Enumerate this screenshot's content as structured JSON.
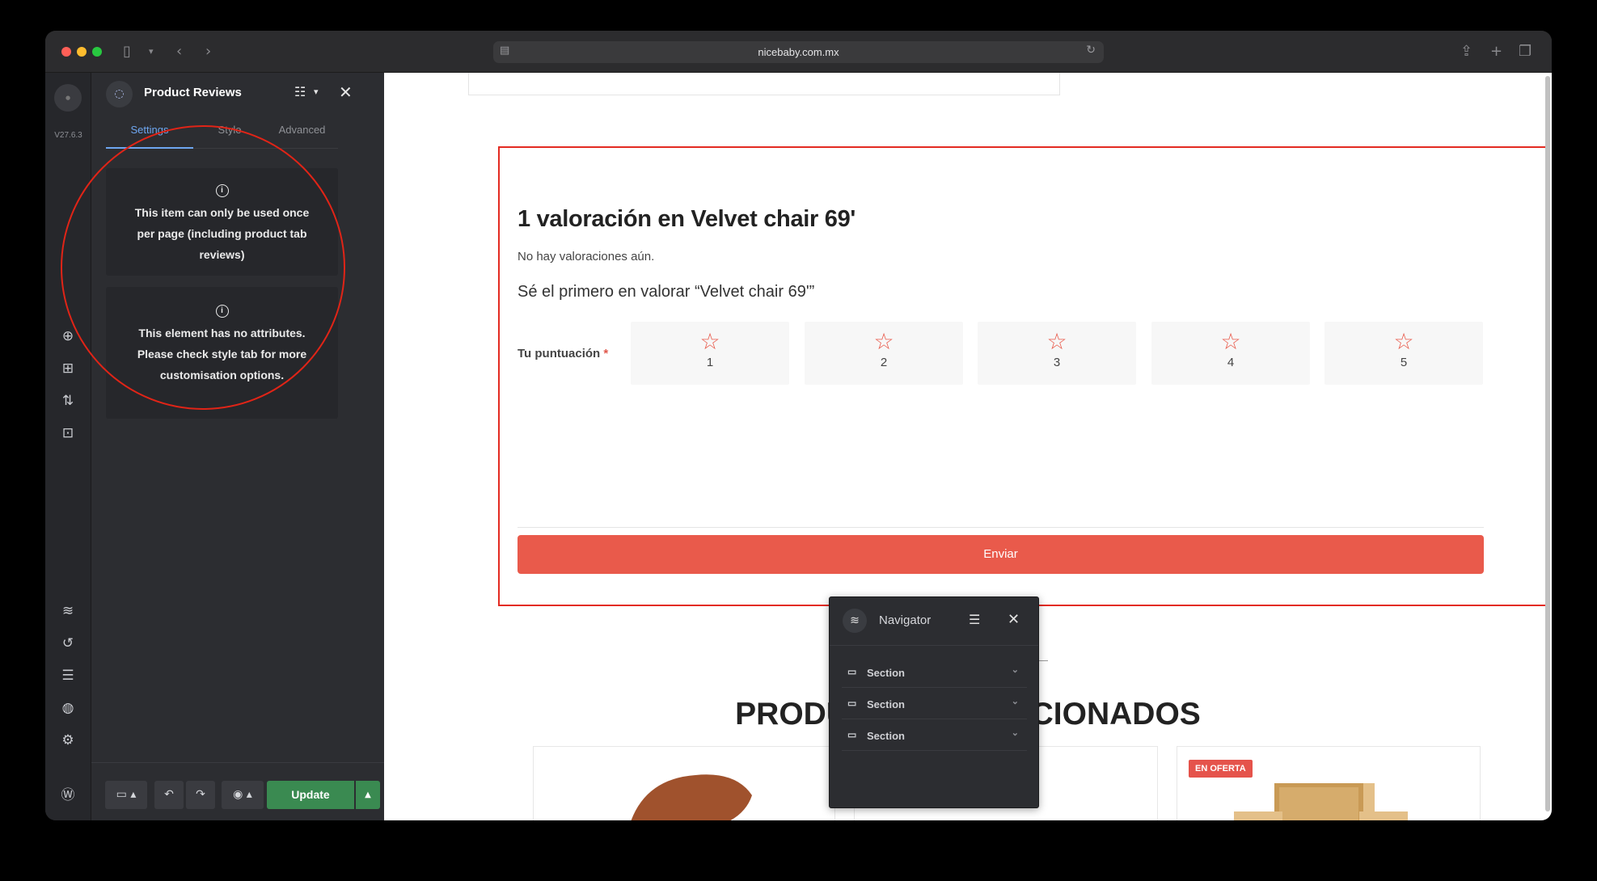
{
  "browser": {
    "url": "nicebaby.com.mx",
    "nav_icons": {
      "sidebar": "sidebar-icon",
      "back": "chevron-left-icon",
      "forward": "chevron-right-icon",
      "share": "share-icon",
      "new_tab": "plus-icon",
      "tabs": "tabs-icon"
    }
  },
  "strip": {
    "version": "V27.6.3"
  },
  "panel": {
    "title": "Product Reviews",
    "tabs": [
      {
        "label": "Settings",
        "active": true
      },
      {
        "label": "Style",
        "active": false
      },
      {
        "label": "Advanced",
        "active": false
      }
    ],
    "notices": [
      "This item can only be used once per page (including product tab reviews)",
      "This element has no attributes. Please check style tab for more customisation options."
    ],
    "footer": {
      "update_label": "Update"
    }
  },
  "review": {
    "title": "1 valoración en Velvet chair 69'",
    "no_reviews": "No hay valoraciones aún.",
    "be_first": "Sé el primero en valorar “Velvet chair 69'”",
    "rating_label": "Tu puntuación",
    "required_mark": "*",
    "stars": [
      "1",
      "2",
      "3",
      "4",
      "5"
    ],
    "submit_label": "Enviar"
  },
  "related": {
    "heading": "PRODUCTOS RELACIONADOS",
    "sale_badge": "EN OFERTA"
  },
  "navigator": {
    "title": "Navigator",
    "rows": [
      "Section",
      "Section",
      "Section"
    ]
  },
  "colors": {
    "accent": "#e95a4b",
    "selection": "#e32b22",
    "update_green": "#3a8a51",
    "tab_active": "#6ea6f0"
  }
}
